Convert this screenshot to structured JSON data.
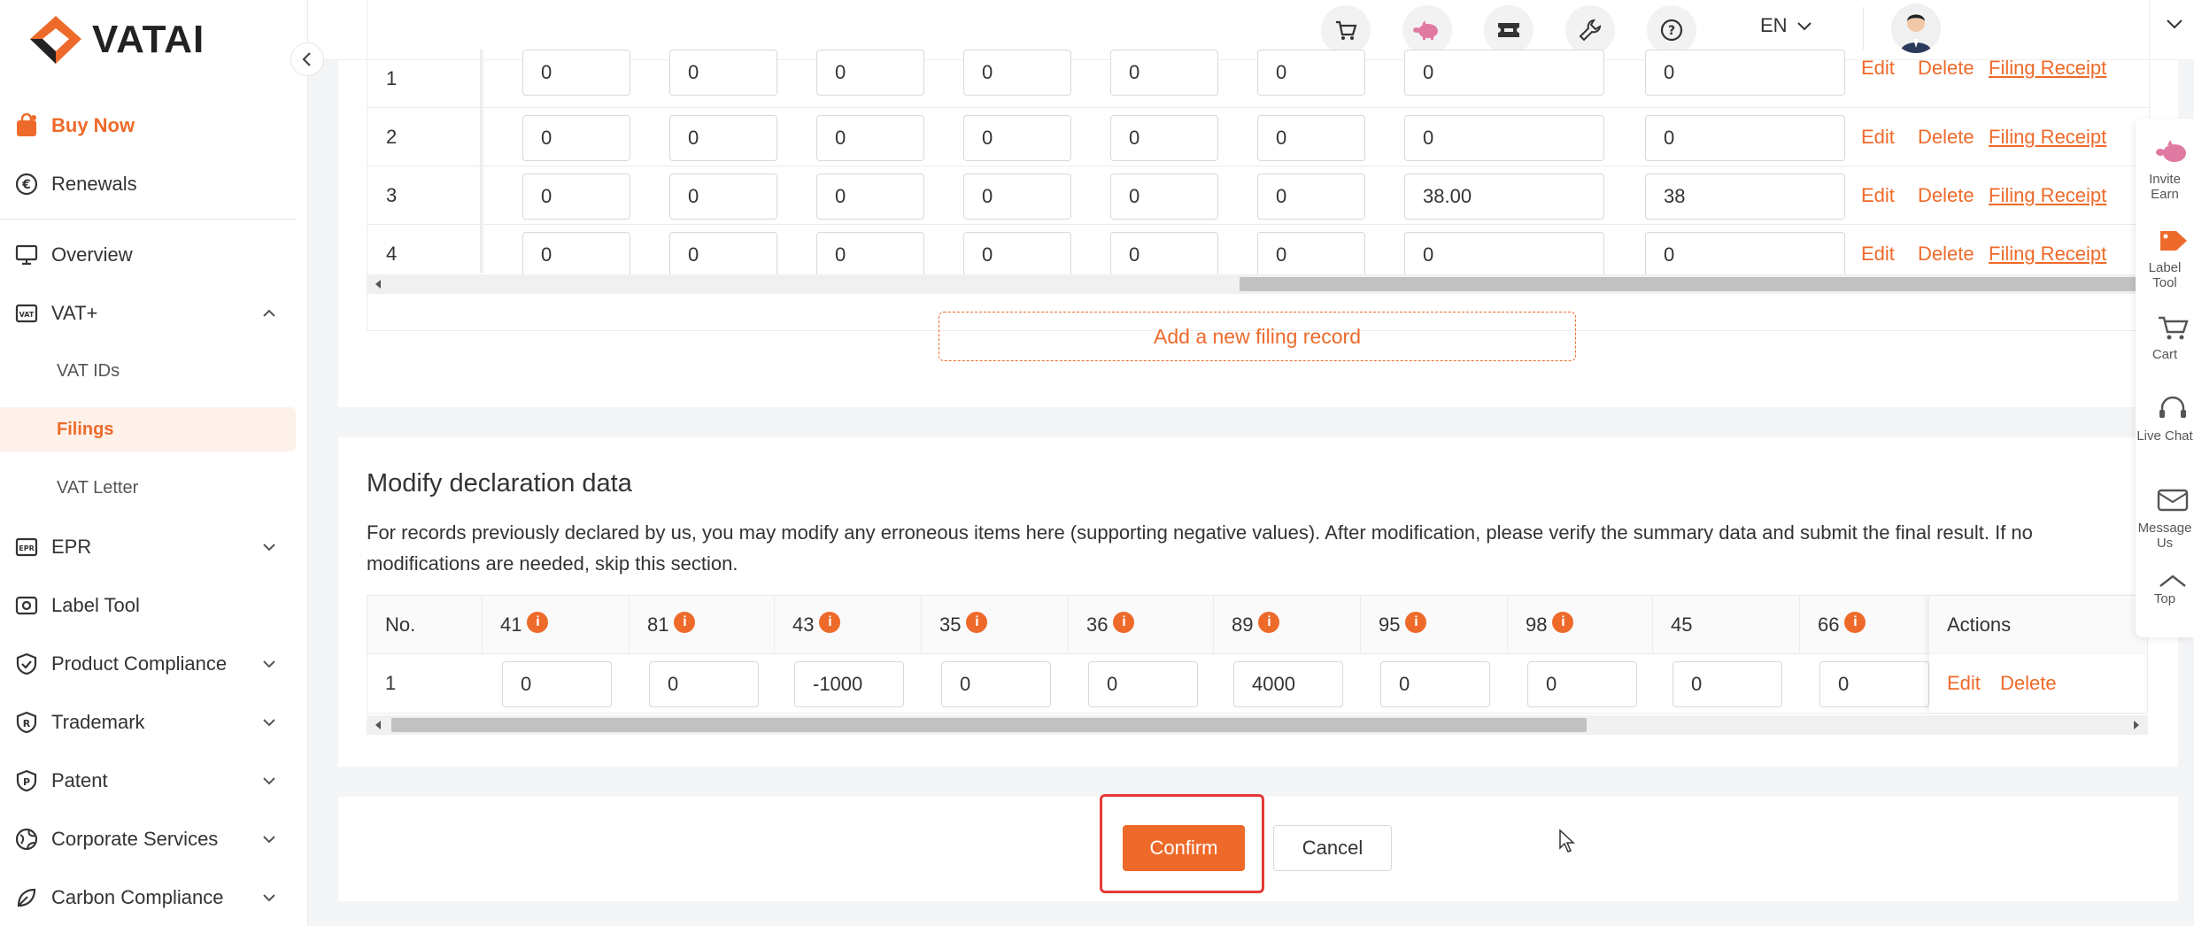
{
  "brand": {
    "name": "VATAI",
    "accent": "#ee6a2a"
  },
  "sidebar": {
    "buy_now": "Buy Now",
    "renewals": "Renewals",
    "overview": "Overview",
    "vat_plus": "VAT+",
    "vat_ids": "VAT IDs",
    "filings": "Filings",
    "vat_letter": "VAT Letter",
    "epr": "EPR",
    "label_tool": "Label Tool",
    "product_compliance": "Product Compliance",
    "trademark": "Trademark",
    "patent": "Patent",
    "corporate_services": "Corporate Services",
    "carbon_compliance": "Carbon Compliance"
  },
  "topbar": {
    "language": "EN"
  },
  "filing_table": {
    "rows": [
      {
        "no": "1",
        "values": [
          "0",
          "0",
          "0",
          "0",
          "0",
          "0",
          "0",
          "0"
        ]
      },
      {
        "no": "2",
        "values": [
          "0",
          "0",
          "0",
          "0",
          "0",
          "0",
          "0",
          "0"
        ]
      },
      {
        "no": "3",
        "values": [
          "0",
          "0",
          "0",
          "0",
          "0",
          "0",
          "38.00",
          "38"
        ]
      },
      {
        "no": "4",
        "values": [
          "0",
          "0",
          "0",
          "0",
          "0",
          "0",
          "0",
          "0"
        ]
      }
    ],
    "edit_label": "Edit",
    "delete_label": "Delete",
    "receipt_label": "Filing Receipt",
    "add_record_label": "Add a new filing record"
  },
  "modify_section": {
    "title": "Modify declaration data",
    "description": "For records previously declared by us, you may modify any erroneous items here (supporting negative values). After modification, please verify the summary data and submit the final result. If no modifications are needed, skip this section.",
    "headers": {
      "no": "No.",
      "c41": "41",
      "c81": "81",
      "c43": "43",
      "c35": "35",
      "c36": "36",
      "c89": "89",
      "c95": "95",
      "c98": "98",
      "c45": "45",
      "c66": "66",
      "actions": "Actions"
    },
    "row": {
      "no": "1",
      "v41": "0",
      "v81": "0",
      "v43": "-1000",
      "v35": "0",
      "v36": "0",
      "v89": "4000",
      "v95": "0",
      "v98": "0",
      "v45": "0",
      "v66": "0"
    },
    "edit_label": "Edit",
    "delete_label": "Delete"
  },
  "footer": {
    "confirm_label": "Confirm",
    "cancel_label": "Cancel"
  },
  "float_panel": {
    "invite": "Invite Earn",
    "label_tool": "Label Tool",
    "cart": "Cart",
    "live_chat": "Live Chat",
    "message": "Message Us",
    "top": "Top"
  }
}
